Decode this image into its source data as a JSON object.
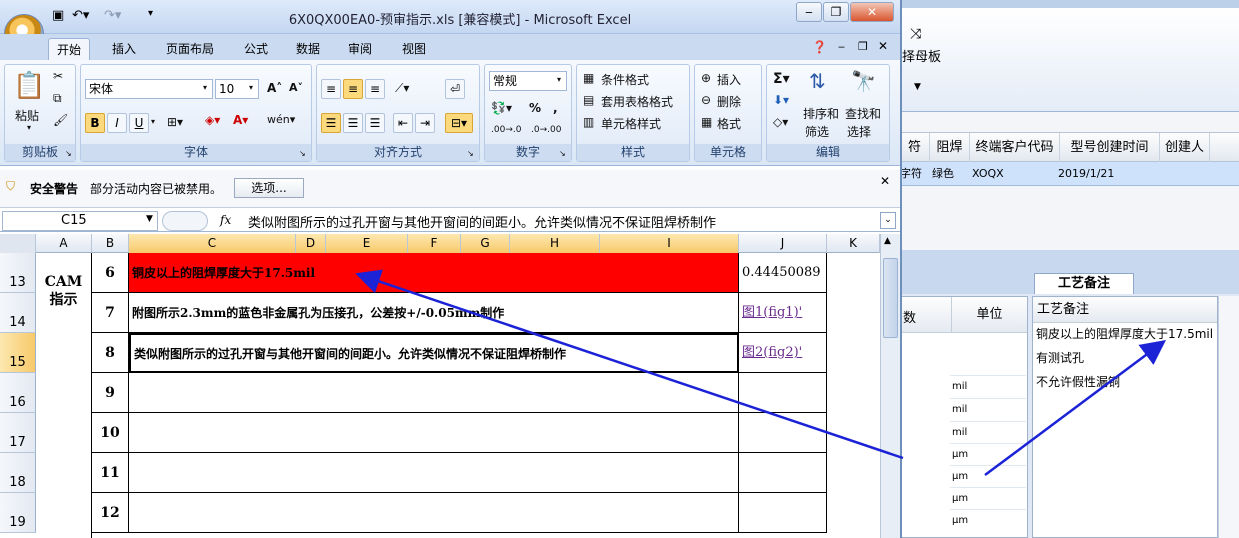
{
  "excel": {
    "title": "6X0QX00EA0-预审指示.xls  [兼容模式] - Microsoft Excel",
    "tabs": [
      "开始",
      "插入",
      "页面布局",
      "公式",
      "数据",
      "审阅",
      "视图"
    ],
    "ribbon": {
      "paste": "粘贴",
      "clipboard": "剪贴板",
      "font_name": "宋体",
      "font_size": "10",
      "font_group": "字体",
      "align_group": "对齐方式",
      "number_format": "常规",
      "number_group": "数字",
      "cond_format": "条件格式",
      "table_format": "套用表格格式",
      "cell_style": "单元格样式",
      "style_group": "样式",
      "insert": "插入",
      "delete": "删除",
      "format": "格式",
      "cells_group": "单元格",
      "sort_filter_1": "排序和",
      "sort_filter_2": "筛选",
      "find_select_1": "查找和",
      "find_select_2": "选择",
      "edit_group": "编辑"
    },
    "security": {
      "title": "安全警告",
      "message": "部分活动内容已被禁用。",
      "options_button": "选项..."
    },
    "name_box": "C15",
    "fx": "fx",
    "formula": "类似附图所示的过孔开窗与其他开窗间的间距小。允许类似情况不保证阻焊桥制作",
    "columns": [
      "A",
      "B",
      "C",
      "D",
      "E",
      "F",
      "G",
      "H",
      "I",
      "J",
      "K"
    ],
    "rows": [
      "13",
      "14",
      "15",
      "16",
      "17",
      "18",
      "19"
    ],
    "merged_label": "CAM指示",
    "table": [
      {
        "num": "6",
        "text": "铜皮以上的阻焊厚度大于17.5mil",
        "j": "0.44450089"
      },
      {
        "num": "7",
        "text": "附图所示2.3mm的蓝色非金属孔为压接孔，公差按+/-0.05mm制作",
        "j": "图1(fig1)'"
      },
      {
        "num": "8",
        "text": "类似附图所示的过孔开窗与其他开窗间的间距小。允许类似情况不保证阻焊桥制作",
        "j": "图2(fig2)'"
      },
      {
        "num": "9",
        "text": "",
        "j": ""
      },
      {
        "num": "10",
        "text": "",
        "j": ""
      },
      {
        "num": "11",
        "text": "",
        "j": ""
      },
      {
        "num": "12",
        "text": "",
        "j": ""
      }
    ]
  },
  "background_app": {
    "toolbar_label": "择母板",
    "headers": [
      "符",
      "阻焊",
      "终端客户代码",
      "型号创建时间",
      "创建人"
    ],
    "row": {
      "c0": "字符",
      "c1": "绿色",
      "c2": "XOQX",
      "c3": "2019/1/21"
    },
    "unit_header": "单位",
    "num_header": "数",
    "units": [
      "mil",
      "mil",
      "mil",
      "μm",
      "μm",
      "μm",
      "μm"
    ],
    "notes_tab": "工艺备注",
    "notes_header": "工艺备注",
    "notes": [
      "铜皮以上的阻焊厚度大于17.5mil",
      "有测试孔",
      "不允许假性漏铜"
    ]
  },
  "colors": {
    "highlight": "#ff0000",
    "arrow": "#1c22d6"
  }
}
